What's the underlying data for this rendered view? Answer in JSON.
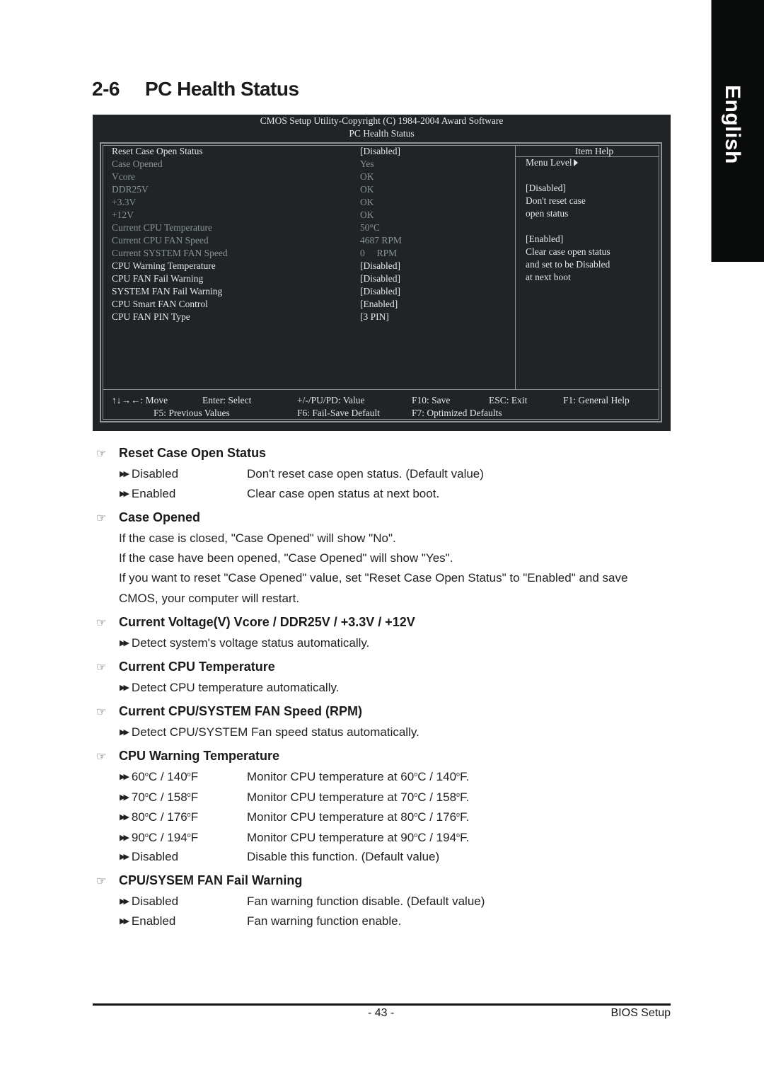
{
  "side_tab": {
    "label": "English"
  },
  "section": {
    "number": "2-6",
    "title": "PC Health Status"
  },
  "bios": {
    "header_line1": "CMOS Setup Utility-Copyright (C) 1984-2004 Award Software",
    "header_line2": "PC Health Status",
    "items": [
      {
        "label": "Reset Case Open Status",
        "value": "[Disabled]",
        "readonly": false
      },
      {
        "label": "Case Opened",
        "value": "Yes",
        "readonly": true
      },
      {
        "label": "Vcore",
        "value": "OK",
        "readonly": true
      },
      {
        "label": "DDR25V",
        "value": "OK",
        "readonly": true
      },
      {
        "label": "+3.3V",
        "value": "OK",
        "readonly": true
      },
      {
        "label": "+12V",
        "value": "OK",
        "readonly": true
      },
      {
        "label": "Current CPU Temperature",
        "value": "50°C",
        "readonly": true
      },
      {
        "label": "Current CPU FAN Speed",
        "value": "4687 RPM",
        "readonly": true
      },
      {
        "label": "Current SYSTEM FAN Speed",
        "value": "0     RPM",
        "readonly": true
      },
      {
        "label": "CPU Warning Temperature",
        "value": "[Disabled]",
        "readonly": false
      },
      {
        "label": "CPU FAN Fail Warning",
        "value": "[Disabled]",
        "readonly": false
      },
      {
        "label": "SYSTEM FAN Fail Warning",
        "value": "[Disabled]",
        "readonly": false
      },
      {
        "label": "CPU Smart FAN Control",
        "value": "[Enabled]",
        "readonly": false
      },
      {
        "label": "CPU FAN PIN Type",
        "value": "[3 PIN]",
        "readonly": false
      }
    ],
    "help": {
      "title": "Item Help",
      "menu_level": "Menu Level",
      "lines": [
        "[Disabled]",
        "Don't reset case",
        "open status",
        "",
        "[Enabled]",
        "Clear case open status",
        "and set to be Disabled",
        "at next boot"
      ]
    },
    "keys": {
      "move": "↑↓→←: Move",
      "enter": "Enter: Select",
      "value": "+/-/PU/PD: Value",
      "f10": "F10: Save",
      "esc": "ESC: Exit",
      "f1": "F1: General Help",
      "f5": "F5: Previous Values",
      "f6": "F6: Fail-Save Default",
      "f7": "F7: Optimized Defaults"
    },
    "colors": {
      "background": "#202426",
      "text": "#e6e6e6",
      "readonly_text": "#8a9494",
      "border": "#8e949a"
    }
  },
  "doc": {
    "reset_case": {
      "title": "Reset Case Open Status",
      "options": [
        {
          "name": "Disabled",
          "desc": "Don't reset case open status. (Default value)"
        },
        {
          "name": "Enabled",
          "desc": "Clear case open status at next boot."
        }
      ]
    },
    "case_opened": {
      "title": "Case Opened",
      "lines": [
        "If the case is closed, \"Case Opened\" will show \"No\".",
        "If the case have been opened, \"Case Opened\" will show \"Yes\".",
        "If you want to reset \"Case Opened\" value, set \"Reset Case Open Status\" to \"Enabled\" and save",
        "CMOS, your computer will restart."
      ]
    },
    "voltage": {
      "title": "Current Voltage(V) Vcore / DDR25V / +3.3V / +12V",
      "note": "Detect system's voltage status automatically."
    },
    "cpu_temp": {
      "title": "Current CPU Temperature",
      "note": "Detect CPU temperature automatically."
    },
    "fan_speed": {
      "title": "Current CPU/SYSTEM FAN Speed (RPM)",
      "note": "Detect CPU/SYSTEM Fan speed status automatically."
    },
    "warn_temp": {
      "title": "CPU Warning Temperature",
      "options": [
        {
          "c": "60",
          "f": "140"
        },
        {
          "c": "70",
          "f": "158"
        },
        {
          "c": "80",
          "f": "176"
        },
        {
          "c": "90",
          "f": "194"
        }
      ],
      "monitor_prefix": "Monitor CPU temperature at ",
      "disabled_name": "Disabled",
      "disabled_desc": "Disable this function. (Default value)"
    },
    "fan_fail": {
      "title": "CPU/SYSEM FAN Fail Warning",
      "options": [
        {
          "name": "Disabled",
          "desc": "Fan warning function disable. (Default value)"
        },
        {
          "name": "Enabled",
          "desc": "Fan warning function enable."
        }
      ]
    }
  },
  "footer": {
    "page": "- 43 -",
    "label": "BIOS Setup"
  }
}
